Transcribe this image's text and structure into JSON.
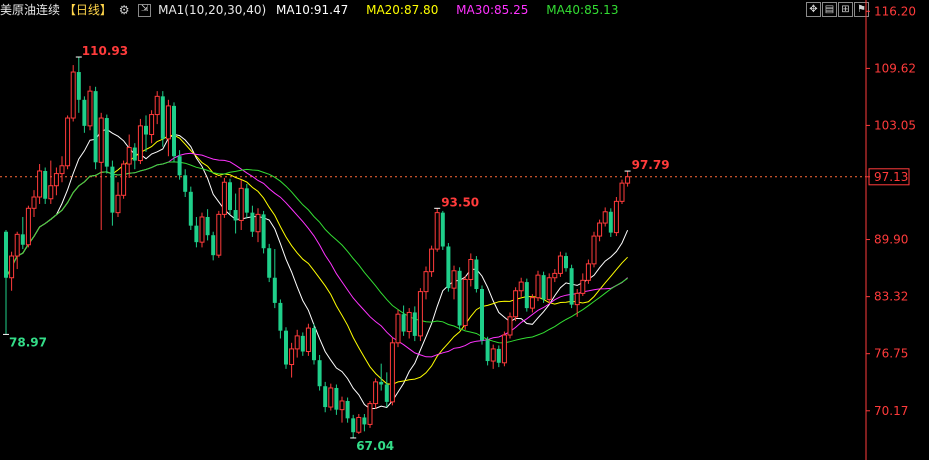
{
  "header": {
    "symbol": "美原油连续",
    "period": "【日线】",
    "ma_title": "MA1(10,20,30,40)",
    "ma10": "MA10:91.47",
    "ma20": "MA20:87.80",
    "ma30": "MA30:85.25",
    "ma40": "MA40:85.13",
    "colors": {
      "ma10": "#ffffff",
      "ma20": "#ffff00",
      "ma30": "#ff33ff",
      "ma40": "#33dd33"
    }
  },
  "toolbar": {
    "icons": [
      "crosshair-icon",
      "layout-icon",
      "chart-grid-icon",
      "flag-icon"
    ]
  },
  "chart_data": {
    "type": "candlestick",
    "ylim": [
      64.5,
      117.5
    ],
    "y_ticks": [
      "116.20",
      "109.62",
      "103.05",
      "97.13",
      "89.90",
      "83.32",
      "76.75",
      "70.17"
    ],
    "current_price": "97.13",
    "colors": {
      "up": "#ff3b3b",
      "down": "#1fcf8a",
      "grid": "#ff3b3b"
    },
    "annotations": {
      "high": "110.93",
      "low_left": "78.97",
      "local_high": "93.50",
      "low": "67.04",
      "last_high": "97.79"
    },
    "ohlc": [
      [
        90.8,
        91.0,
        78.97,
        85.5
      ],
      [
        85.5,
        88.5,
        84.0,
        88.0
      ],
      [
        88.0,
        90.8,
        86.5,
        90.5
      ],
      [
        90.5,
        92.5,
        88.8,
        89.3
      ],
      [
        89.3,
        93.8,
        89.0,
        93.5
      ],
      [
        93.5,
        95.6,
        92.5,
        94.8
      ],
      [
        94.8,
        98.6,
        94.0,
        97.8
      ],
      [
        97.8,
        98.2,
        94.0,
        94.6
      ],
      [
        94.6,
        99.0,
        94.0,
        96.1
      ],
      [
        96.1,
        98.2,
        95.0,
        97.5
      ],
      [
        97.5,
        99.5,
        96.5,
        98.4
      ],
      [
        98.4,
        104.2,
        98.0,
        103.9
      ],
      [
        103.9,
        110.0,
        103.5,
        109.2
      ],
      [
        109.2,
        110.93,
        104.5,
        106.0
      ],
      [
        106.0,
        106.4,
        102.2,
        103.0
      ],
      [
        103.0,
        107.6,
        102.5,
        107.0
      ],
      [
        107.0,
        107.5,
        98.0,
        98.8
      ],
      [
        98.8,
        104.5,
        91.0,
        103.9
      ],
      [
        103.9,
        104.3,
        97.5,
        98.3
      ],
      [
        98.3,
        99.0,
        91.5,
        93.0
      ],
      [
        93.0,
        96.5,
        92.5,
        95.0
      ],
      [
        95.0,
        99.0,
        94.6,
        98.6
      ],
      [
        98.6,
        102.0,
        97.0,
        100.5
      ],
      [
        100.5,
        101.0,
        98.0,
        99.0
      ],
      [
        99.0,
        103.8,
        98.6,
        103.0
      ],
      [
        103.0,
        104.2,
        100.0,
        102.0
      ],
      [
        102.0,
        104.8,
        101.0,
        104.3
      ],
      [
        104.3,
        107.0,
        103.2,
        106.4
      ],
      [
        106.4,
        107.0,
        100.6,
        101.5
      ],
      [
        101.5,
        106.0,
        99.5,
        105.3
      ],
      [
        105.3,
        105.7,
        98.8,
        99.5
      ],
      [
        99.5,
        100.2,
        96.8,
        97.3
      ],
      [
        97.3,
        98.0,
        94.8,
        95.4
      ],
      [
        95.4,
        96.0,
        91.0,
        91.5
      ],
      [
        91.5,
        92.5,
        89.0,
        89.6
      ],
      [
        89.6,
        93.0,
        89.0,
        92.5
      ],
      [
        92.5,
        93.4,
        89.8,
        90.4
      ],
      [
        90.4,
        90.8,
        87.5,
        88.1
      ],
      [
        88.1,
        93.2,
        87.8,
        92.8
      ],
      [
        92.8,
        97.0,
        92.4,
        96.5
      ],
      [
        96.5,
        96.9,
        92.8,
        93.3
      ],
      [
        93.3,
        95.2,
        90.6,
        92.1
      ],
      [
        92.1,
        96.8,
        91.0,
        95.8
      ],
      [
        95.8,
        96.3,
        92.4,
        93.0
      ],
      [
        93.0,
        93.8,
        90.2,
        90.8
      ],
      [
        90.8,
        93.5,
        89.6,
        92.8
      ],
      [
        92.8,
        93.2,
        88.3,
        88.9
      ],
      [
        88.9,
        89.4,
        85.0,
        85.5
      ],
      [
        85.5,
        88.8,
        82.0,
        82.6
      ],
      [
        82.6,
        83.0,
        78.5,
        79.4
      ],
      [
        79.4,
        79.8,
        75.0,
        75.5
      ],
      [
        75.5,
        78.0,
        74.0,
        77.3
      ],
      [
        77.3,
        79.5,
        76.3,
        78.8
      ],
      [
        78.8,
        79.2,
        76.5,
        77.0
      ],
      [
        77.0,
        80.2,
        76.5,
        79.7
      ],
      [
        79.7,
        80.2,
        75.5,
        76.0
      ],
      [
        76.0,
        76.6,
        72.5,
        73.0
      ],
      [
        73.0,
        73.5,
        70.0,
        70.6
      ],
      [
        70.6,
        73.3,
        70.2,
        72.8
      ],
      [
        72.8,
        73.2,
        69.7,
        70.3
      ],
      [
        70.3,
        71.8,
        68.8,
        71.3
      ],
      [
        71.3,
        71.7,
        68.8,
        69.3
      ],
      [
        69.3,
        69.7,
        67.04,
        67.7
      ],
      [
        67.7,
        69.8,
        67.5,
        69.4
      ],
      [
        69.4,
        69.8,
        67.8,
        68.6
      ],
      [
        68.6,
        71.3,
        68.2,
        71.0
      ],
      [
        71.0,
        73.9,
        70.4,
        73.5
      ],
      [
        73.5,
        75.6,
        72.5,
        73.2
      ],
      [
        73.2,
        74.6,
        70.6,
        71.2
      ],
      [
        71.2,
        78.6,
        70.8,
        78.0
      ],
      [
        78.0,
        81.8,
        77.5,
        81.3
      ],
      [
        81.3,
        82.3,
        78.8,
        79.3
      ],
      [
        79.3,
        82.0,
        78.5,
        81.5
      ],
      [
        81.5,
        82.2,
        78.2,
        78.8
      ],
      [
        78.8,
        84.3,
        78.2,
        83.9
      ],
      [
        83.9,
        86.8,
        83.0,
        86.2
      ],
      [
        86.2,
        89.2,
        85.6,
        88.8
      ],
      [
        88.8,
        93.5,
        88.5,
        93.0
      ],
      [
        93.0,
        93.2,
        88.7,
        89.1
      ],
      [
        89.1,
        89.5,
        83.9,
        84.3
      ],
      [
        84.3,
        86.9,
        83.0,
        86.3
      ],
      [
        86.3,
        86.7,
        79.5,
        80.0
      ],
      [
        80.0,
        85.7,
        79.5,
        85.3
      ],
      [
        85.3,
        88.3,
        84.5,
        87.6
      ],
      [
        87.6,
        88.0,
        83.8,
        84.2
      ],
      [
        84.2,
        84.6,
        77.8,
        78.3
      ],
      [
        78.3,
        78.7,
        75.4,
        75.9
      ],
      [
        75.9,
        77.8,
        75.0,
        77.3
      ],
      [
        77.3,
        77.7,
        75.2,
        75.7
      ],
      [
        75.7,
        79.3,
        75.3,
        78.9
      ],
      [
        78.9,
        81.5,
        78.5,
        81.0
      ],
      [
        81.0,
        84.4,
        80.5,
        84.0
      ],
      [
        84.0,
        85.5,
        83.3,
        85.0
      ],
      [
        85.0,
        85.4,
        81.6,
        82.0
      ],
      [
        82.0,
        83.6,
        81.5,
        83.2
      ],
      [
        83.2,
        86.3,
        82.8,
        85.8
      ],
      [
        85.8,
        86.2,
        82.6,
        83.0
      ],
      [
        83.0,
        86.0,
        82.6,
        85.5
      ],
      [
        85.5,
        86.5,
        85.0,
        86.0
      ],
      [
        86.0,
        88.5,
        85.6,
        88.0
      ],
      [
        88.0,
        88.4,
        86.2,
        86.6
      ],
      [
        86.6,
        87.0,
        82.0,
        82.4
      ],
      [
        82.4,
        84.2,
        81.0,
        83.7
      ],
      [
        83.7,
        86.0,
        83.4,
        85.2
      ],
      [
        85.2,
        87.6,
        84.8,
        87.1
      ],
      [
        87.1,
        90.8,
        86.7,
        90.3
      ],
      [
        90.3,
        92.2,
        89.7,
        91.8
      ],
      [
        91.8,
        93.6,
        91.4,
        93.1
      ],
      [
        93.1,
        93.5,
        90.2,
        90.7
      ],
      [
        90.7,
        94.8,
        90.3,
        94.3
      ],
      [
        94.3,
        96.8,
        94.0,
        96.4
      ],
      [
        96.4,
        97.79,
        96.0,
        97.13
      ]
    ]
  }
}
